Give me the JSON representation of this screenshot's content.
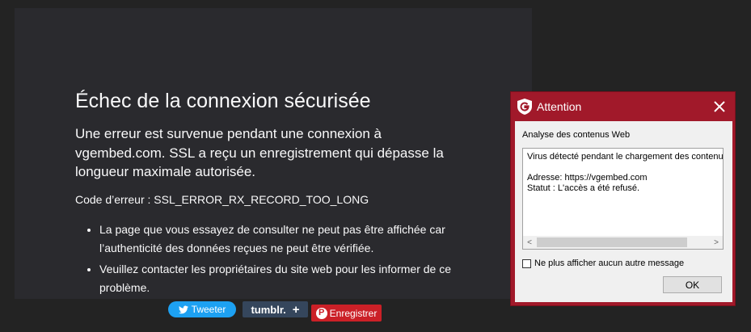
{
  "error_page": {
    "title": "Échec de la connexion sécurisée",
    "description": "Une erreur est survenue pendant une connexion à vgembed.com. SSL a reçu un enregistrement qui dépasse la longueur maximale autorisée.",
    "error_code": "Code d’erreur : SSL_ERROR_RX_RECORD_TOO_LONG",
    "bullets": [
      "La page que vous essayez de consulter ne peut pas être affichée car l’authenticité des données reçues ne peut être vérifiée.",
      "Veuillez contacter les propriétaires du site web pour les informer de ce problème."
    ]
  },
  "share": {
    "twitter_label": "Tweeter",
    "tumblr_label": "tumblr.",
    "tumblr_plus": "+",
    "pinterest_label": "Enregistrer",
    "pinterest_icon_glyph": "P",
    "twitter_color": "#1da1f2",
    "tumblr_color": "#35465c",
    "pinterest_color": "#cb2027"
  },
  "av_dialog": {
    "title": "Attention",
    "section_label": "Analyse des contenus Web",
    "message_lines": [
      "Virus détecté pendant le chargement des contenu",
      "",
      "Adresse: https://vgembed.com",
      "Statut :  L'accès a été refusé."
    ],
    "scroll_left_glyph": "<",
    "scroll_right_glyph": ">",
    "checkbox_label": "Ne plus afficher aucun autre message",
    "checkbox_checked": false,
    "ok_label": "OK",
    "accent_color": "#a1192a",
    "logo_icon": "gdata-shield-icon",
    "close_icon": "close-icon"
  },
  "colors": {
    "page_background": "#232323",
    "panel_background": "#2a2a2e",
    "panel_text": "#f9f9fa"
  }
}
